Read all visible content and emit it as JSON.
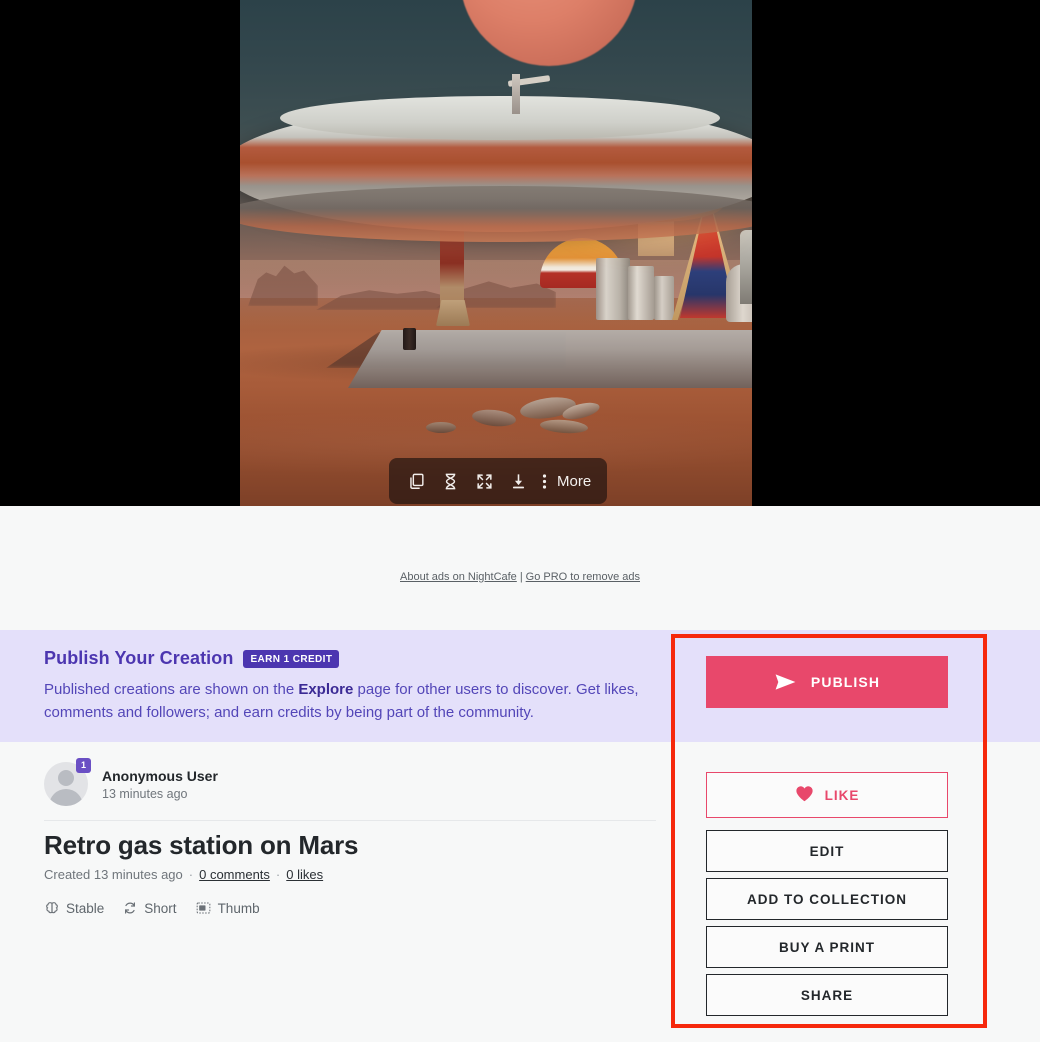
{
  "image_toolbar": {
    "buttons": [
      {
        "name": "copy-icon",
        "label": "Copy"
      },
      {
        "name": "hourglass-icon",
        "label": "Evolve"
      },
      {
        "name": "expand-icon",
        "label": "Fullscreen"
      },
      {
        "name": "download-icon",
        "label": "Download"
      }
    ],
    "more_label": "More"
  },
  "ads": {
    "about_link": "About ads on NightCafe",
    "separator": "|",
    "pro_link": "Go PRO to remove ads"
  },
  "publish_banner": {
    "title": "Publish Your Creation",
    "badge": "EARN 1 CREDIT",
    "body_part1": "Published creations are shown on the ",
    "body_bold": "Explore",
    "body_part2": " page for other users to discover. Get likes, comments and followers; and earn credits by being part of the community."
  },
  "creator": {
    "name": "Anonymous User",
    "time": "13 minutes ago",
    "badge_count": "1"
  },
  "artwork": {
    "title": "Retro gas station on Mars",
    "created": "Created 13 minutes ago",
    "comments": "0 comments",
    "likes": "0 likes",
    "chips": [
      {
        "icon": "brain-icon",
        "label": "Stable"
      },
      {
        "icon": "refresh-icon",
        "label": "Short"
      },
      {
        "icon": "thumbnail-icon",
        "label": "Thumb"
      }
    ]
  },
  "sidebar": {
    "publish_label": "PUBLISH",
    "publish_icon": "send-icon",
    "actions": [
      {
        "label": "LIKE",
        "icon": "heart-icon",
        "style": "like"
      },
      {
        "label": "EDIT",
        "icon": "",
        "style": "plain"
      },
      {
        "label": "ADD TO COLLECTION",
        "icon": "",
        "style": "plain"
      },
      {
        "label": "BUY A PRINT",
        "icon": "",
        "style": "plain"
      },
      {
        "label": "SHARE",
        "icon": "",
        "style": "plain"
      }
    ]
  },
  "colors": {
    "publish_accent": "#e8486b",
    "banner_bg": "#e4e0fa",
    "banner_text": "#4c36b0",
    "annotation_border": "#f6280c",
    "page_bg": "#f7f8f8"
  }
}
